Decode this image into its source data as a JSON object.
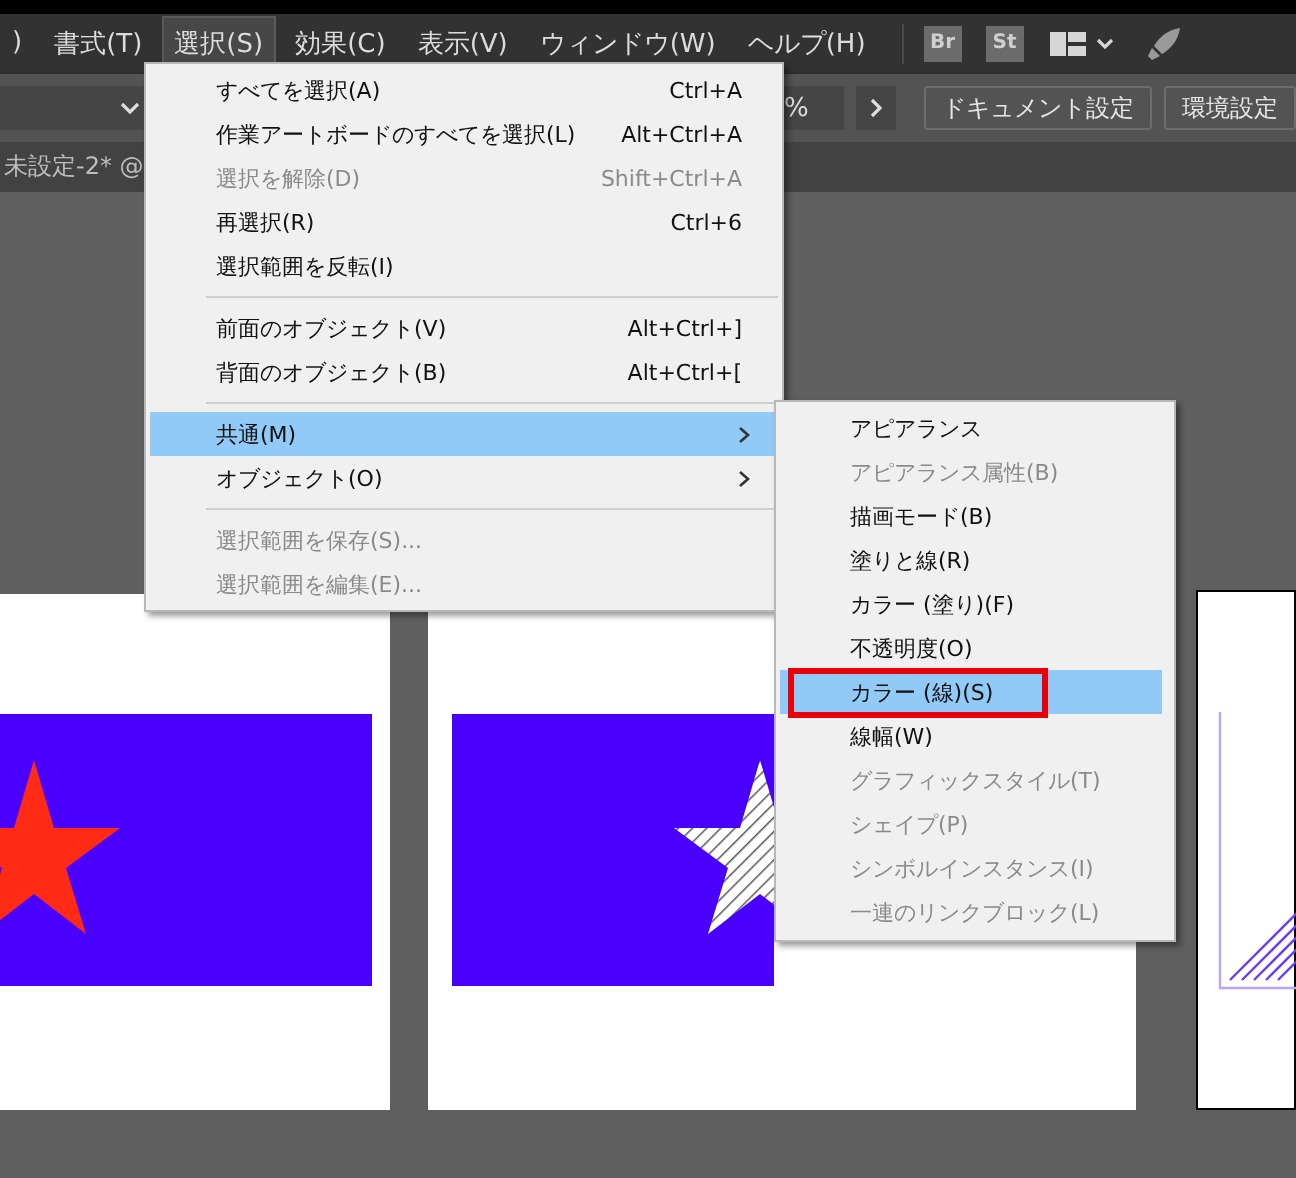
{
  "menubar": {
    "items": [
      {
        "label": ")",
        "selected": false
      },
      {
        "label": "書式(T)",
        "selected": false
      },
      {
        "label": "選択(S)",
        "selected": true
      },
      {
        "label": "効果(C)",
        "selected": false
      },
      {
        "label": "表示(V)",
        "selected": false
      },
      {
        "label": "ウィンドウ(W)",
        "selected": false
      },
      {
        "label": "ヘルプ(H)",
        "selected": false
      }
    ],
    "app_icons": [
      "Br",
      "St"
    ]
  },
  "control_bar": {
    "zoom_unit": "%",
    "buttons": [
      "ドキュメント設定",
      "環境設定"
    ]
  },
  "document_tab": {
    "title": "未設定-2* @"
  },
  "menu": {
    "items": [
      {
        "kind": "item",
        "label": "すべてを選択(A)",
        "shortcut": "Ctrl+A",
        "disabled": false,
        "selected": false
      },
      {
        "kind": "item",
        "label": "作業アートボードのすべてを選択(L)",
        "shortcut": "Alt+Ctrl+A",
        "disabled": false,
        "selected": false
      },
      {
        "kind": "item",
        "label": "選択を解除(D)",
        "shortcut": "Shift+Ctrl+A",
        "disabled": true,
        "selected": false
      },
      {
        "kind": "item",
        "label": "再選択(R)",
        "shortcut": "Ctrl+6",
        "disabled": false,
        "selected": false
      },
      {
        "kind": "item",
        "label": "選択範囲を反転(I)",
        "disabled": false,
        "selected": false
      },
      {
        "kind": "separator"
      },
      {
        "kind": "item",
        "label": "前面のオブジェクト(V)",
        "shortcut": "Alt+Ctrl+]",
        "disabled": false,
        "selected": false
      },
      {
        "kind": "item",
        "label": "背面のオブジェクト(B)",
        "shortcut": "Alt+Ctrl+[",
        "disabled": false,
        "selected": false
      },
      {
        "kind": "separator"
      },
      {
        "kind": "submenu",
        "label": "共通(M)",
        "disabled": false,
        "selected": true
      },
      {
        "kind": "submenu",
        "label": "オブジェクト(O)",
        "disabled": false,
        "selected": false
      },
      {
        "kind": "separator"
      },
      {
        "kind": "item",
        "label": "選択範囲を保存(S)...",
        "disabled": true,
        "selected": false
      },
      {
        "kind": "item",
        "label": "選択範囲を編集(E)...",
        "disabled": true,
        "selected": false
      }
    ]
  },
  "submenu": {
    "items": [
      {
        "label": "アピアランス",
        "disabled": false,
        "selected": false,
        "outlined": false
      },
      {
        "label": "アピアランス属性(B)",
        "disabled": true,
        "selected": false,
        "outlined": false
      },
      {
        "label": "描画モード(B)",
        "disabled": false,
        "selected": false,
        "outlined": false
      },
      {
        "label": "塗りと線(R)",
        "disabled": false,
        "selected": false,
        "outlined": false
      },
      {
        "label": "カラー (塗り)(F)",
        "disabled": false,
        "selected": false,
        "outlined": false
      },
      {
        "label": "不透明度(O)",
        "disabled": false,
        "selected": false,
        "outlined": false
      },
      {
        "label": "カラー (線)(S)",
        "disabled": false,
        "selected": true,
        "outlined": true
      },
      {
        "label": "線幅(W)",
        "disabled": false,
        "selected": false,
        "outlined": false
      },
      {
        "label": "グラフィックスタイル(T)",
        "disabled": true,
        "selected": false,
        "outlined": false
      },
      {
        "label": "シェイプ(P)",
        "disabled": true,
        "selected": false,
        "outlined": false
      },
      {
        "label": "シンボルインスタンス(I)",
        "disabled": true,
        "selected": false,
        "outlined": false
      },
      {
        "label": "一連のリンクブロック(L)",
        "disabled": true,
        "selected": false,
        "outlined": false
      }
    ]
  }
}
